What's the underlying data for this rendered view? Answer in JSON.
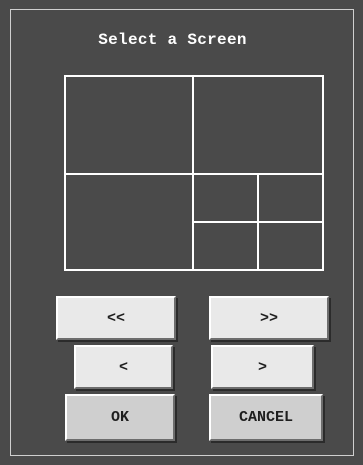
{
  "dialog": {
    "title": "Select a Screen"
  },
  "nav": {
    "first_label": "<<",
    "last_label": ">>",
    "prev_label": "<",
    "next_label": ">"
  },
  "actions": {
    "ok_label": "OK",
    "cancel_label": "CANCEL"
  },
  "colors": {
    "background": "#4a4a4a",
    "layout_lines": "#ffffff",
    "button_face": "#e9e9e9",
    "button_face_dark": "#cfcfcf"
  }
}
